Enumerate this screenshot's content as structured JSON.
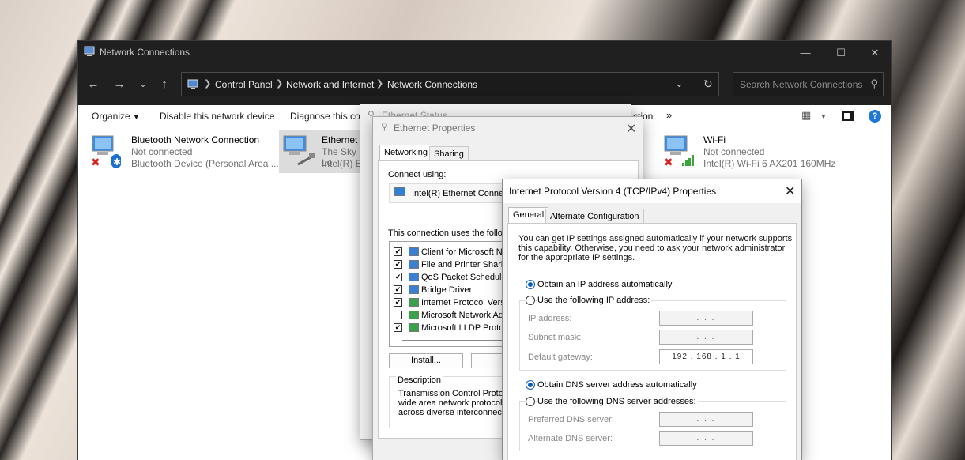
{
  "window": {
    "title": "Network Connections"
  },
  "address": {
    "crumbs": [
      "Control Panel",
      "Network and Internet",
      "Network Connections"
    ],
    "search_placeholder": "Search Network Connections"
  },
  "toolbar": {
    "organize": "Organize",
    "disable": "Disable this network device",
    "diagnose": "Diagnose this con",
    "more_tail": "ction",
    "overflow": "»"
  },
  "items": [
    {
      "name": "Bluetooth Network Connection",
      "status": "Not connected",
      "device": "Bluetooth Device (Personal Area ..."
    },
    {
      "name": "Ethernet",
      "status": "The Sky Lo",
      "device": "Intel(R) Et"
    },
    {
      "name": "Wi-Fi",
      "status": "Not connected",
      "device": "Intel(R) Wi-Fi 6 AX201 160MHz"
    }
  ],
  "status_dialog": {
    "title": "Ethernet Status"
  },
  "props_dialog": {
    "title": "Ethernet Properties",
    "tabs": [
      "Networking",
      "Sharing"
    ],
    "connect_using_label": "Connect using:",
    "adapter": "Intel(R) Ethernet Connecti",
    "uses_label": "This connection uses the followin",
    "components": [
      {
        "label": "Client for Microsoft Netw",
        "checked": true
      },
      {
        "label": "File and Printer Sharing",
        "checked": true
      },
      {
        "label": "QoS Packet Scheduler",
        "checked": true
      },
      {
        "label": "Bridge Driver",
        "checked": true
      },
      {
        "label": "Internet Protocol Versio",
        "checked": true
      },
      {
        "label": "Microsoft Network Adap",
        "checked": false
      },
      {
        "label": "Microsoft LLDP Protoco",
        "checked": true
      }
    ],
    "install_button": "Install...",
    "uninstall_button": "Un",
    "description_label": "Description",
    "description_lines": [
      "Transmission Control Protocol",
      "wide area network protocol th",
      "across diverse interconnected"
    ]
  },
  "ipv4_dialog": {
    "title": "Internet Protocol Version 4 (TCP/IPv4) Properties",
    "tabs": [
      "General",
      "Alternate Configuration"
    ],
    "intro_lines": [
      "You can get IP settings assigned automatically if your network supports",
      "this capability. Otherwise, you need to ask your network administrator",
      "for the appropriate IP settings."
    ],
    "obtain_ip_auto": "Obtain an IP address automatically",
    "use_following_ip": "Use the following IP address:",
    "ip_address_label": "IP address:",
    "subnet_label": "Subnet mask:",
    "gateway_label": "Default gateway:",
    "empty_ip": ".      .      .",
    "gateway_value": "192 . 168 .  1  .  1",
    "obtain_dns_auto": "Obtain DNS server address automatically",
    "use_following_dns": "Use the following DNS server addresses:",
    "preferred_dns_label": "Preferred DNS server:",
    "alternate_dns_label": "Alternate DNS server:"
  }
}
